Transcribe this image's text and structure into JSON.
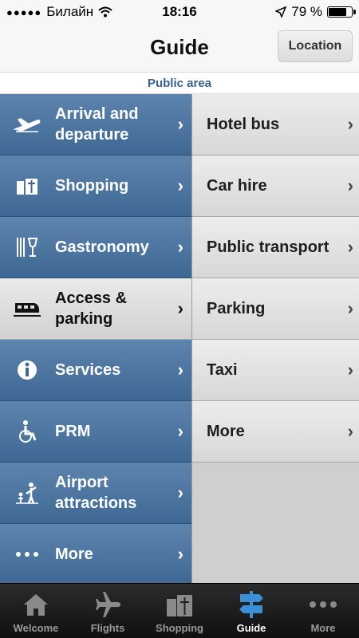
{
  "status_bar": {
    "carrier": "Билайн",
    "time": "18:16",
    "battery": "79 %",
    "battery_level_percent": 79
  },
  "nav": {
    "title": "Guide",
    "location_button": "Location"
  },
  "subheader": "Public area",
  "categories": [
    {
      "label": "Arrival and departure",
      "icon": "airplane-icon",
      "active": false
    },
    {
      "label": "Shopping",
      "icon": "shopping-bag-icon",
      "active": false
    },
    {
      "label": "Gastronomy",
      "icon": "fork-knife-glass-icon",
      "active": false
    },
    {
      "label": "Access & parking",
      "icon": "train-icon",
      "active": true
    },
    {
      "label": "Services",
      "icon": "info-icon",
      "active": false
    },
    {
      "label": "PRM",
      "icon": "wheelchair-icon",
      "active": false
    },
    {
      "label": "Airport attractions",
      "icon": "family-icon",
      "active": false
    },
    {
      "label": "More",
      "icon": "more-dots-icon",
      "active": false
    }
  ],
  "subcategories": [
    {
      "label": "Hotel bus"
    },
    {
      "label": "Car hire"
    },
    {
      "label": "Public transport"
    },
    {
      "label": "Parking"
    },
    {
      "label": "Taxi"
    },
    {
      "label": "More"
    }
  ],
  "chevron": "›",
  "tabs": [
    {
      "label": "Welcome",
      "icon": "house-icon",
      "active": false
    },
    {
      "label": "Flights",
      "icon": "airplane-icon",
      "active": false
    },
    {
      "label": "Shopping",
      "icon": "shopping-bag-icon",
      "active": false
    },
    {
      "label": "Guide",
      "icon": "signpost-icon",
      "active": true
    },
    {
      "label": "More",
      "icon": "more-dots-icon",
      "active": false
    }
  ],
  "colors": {
    "accent_blue": "#3e6893",
    "active_tab": "#3a8fd6"
  }
}
